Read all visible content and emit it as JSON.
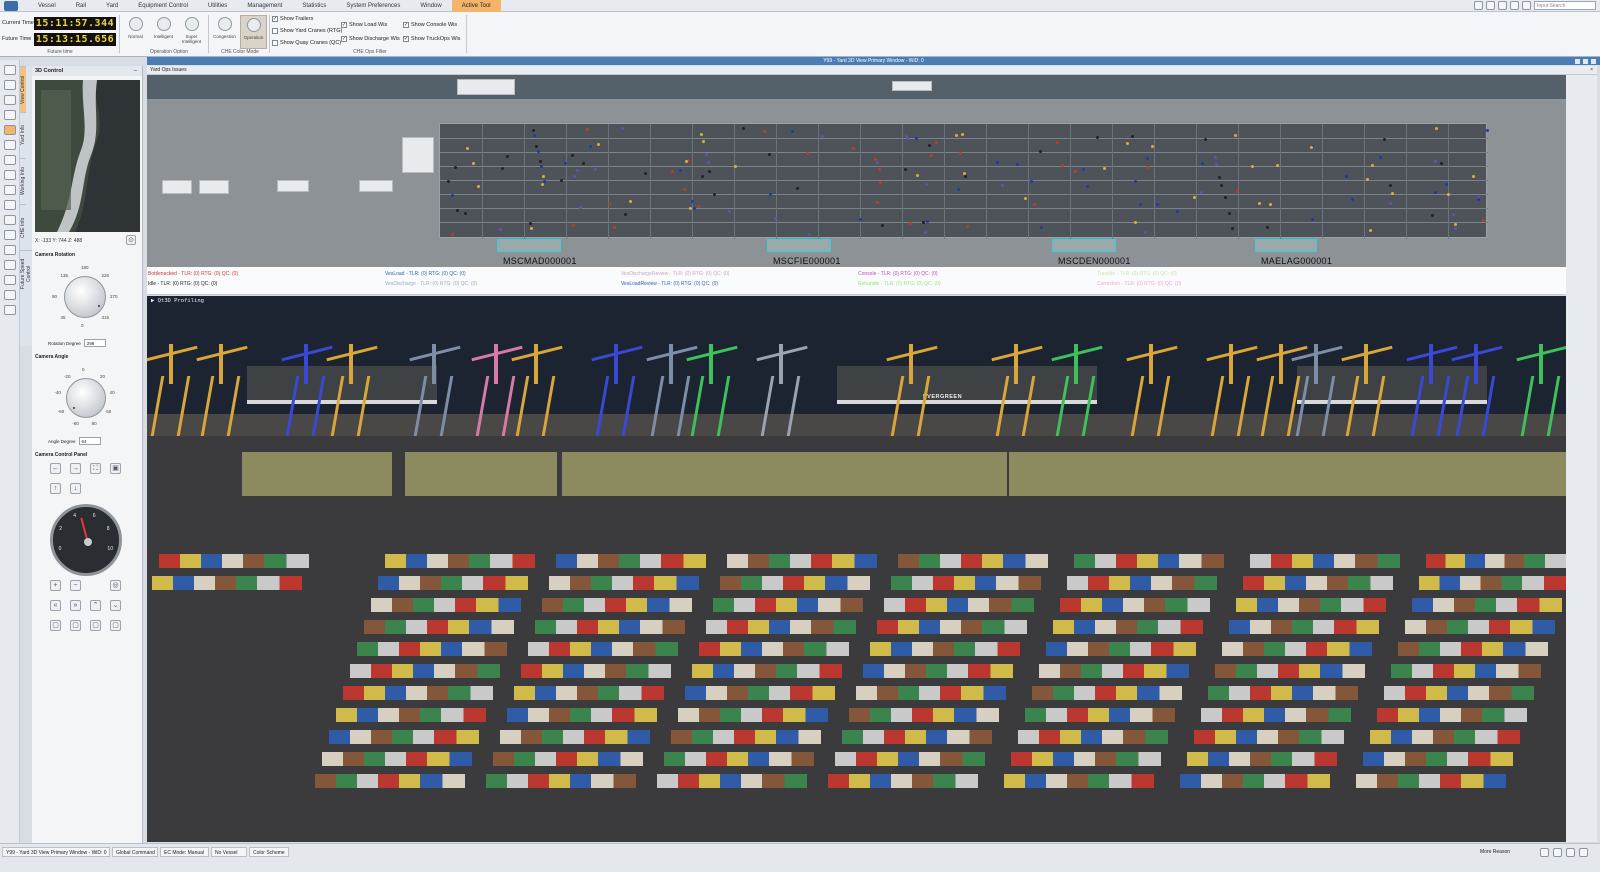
{
  "menubar": {
    "items": [
      "Vessel",
      "Rail",
      "Yard",
      "Equipment Control",
      "Utilities",
      "Management",
      "Statistics",
      "System Preferences",
      "Window",
      "Active Tool"
    ],
    "active_index": 9,
    "search_placeholder": "Input Search"
  },
  "ribbon": {
    "current_time_label": "Current Time",
    "current_time": "15:11:57.344",
    "future_time_label": "Future Time",
    "future_time": "15:13:15.656",
    "future_time_caption": "Future time",
    "operation_buttons": [
      "Normal",
      "Intelligent",
      "Super Intelligent"
    ],
    "operation_caption": "Operation Option",
    "che_buttons": [
      "Congestion",
      "Operation"
    ],
    "che_caption": "CHE Color Mode",
    "che_pressed": "Operation",
    "filters_col1": [
      {
        "label": "Show Trailers",
        "checked": true
      },
      {
        "label": "Show Yard Cranes (RTG)",
        "checked": false
      },
      {
        "label": "Show Quay Cranes (QC)",
        "checked": false
      }
    ],
    "filters_col2": [
      {
        "label": "Show Load Wis",
        "checked": true
      },
      {
        "label": "Show Discharge Wis",
        "checked": true
      }
    ],
    "filters_col3": [
      {
        "label": "Show Console Wis",
        "checked": true
      },
      {
        "label": "Show TruckOps Wis",
        "checked": true
      }
    ],
    "filter_caption": "CHE Ops Filter"
  },
  "window_title": "Y99 - Yard 3D View Primary Window - WiD: 0",
  "left_panel": {
    "title": "3D Control",
    "vertical_tabs": [
      "View Control",
      "Yard Info",
      "Working Info",
      "CHE Info",
      "Future Speed Control"
    ],
    "coords": "X: -133   Y: 744   Z: 488",
    "camera_rotation_label": "Camera Rotation",
    "rotation_ticks": [
      "180",
      "225",
      "270",
      "315",
      "0",
      "45",
      "90",
      "135"
    ],
    "rotation_degree_label": "Rotation Degree",
    "rotation_degree": "298",
    "camera_angle_label": "Camera Angle",
    "angle_ticks": [
      "0",
      "20",
      "40",
      "60",
      "80",
      "-80",
      "-60",
      "-40",
      "-20"
    ],
    "angle_degree_label": "Angle Degree",
    "angle_degree": "64",
    "camera_panel_label": "Camera Control Panel",
    "dial_numbers": [
      "0",
      "2",
      "4",
      "6",
      "8",
      "10"
    ]
  },
  "map": {
    "tab_label": "Yard Ops Issues",
    "vessels": [
      "MSCMAD000001",
      "MSCFIE000001",
      "MSCDEN000001",
      "MAELAG000001"
    ],
    "legend": [
      {
        "text": "Bottlenecked - TLR: (0) RTG: (0) QC: (0)",
        "color": "#d0342c"
      },
      {
        "text": "Idle - TLR: (0) RTG: (0) QC: (0)",
        "color": "#222222"
      },
      {
        "text": "VesLoad - TLR: (0) RTG: (0) QC: (0)",
        "color": "#2f5fb3"
      },
      {
        "text": "VesDischarge - TLR: (0) RTG: (0) QC: (0)",
        "color": "#9aa9c8"
      },
      {
        "text": "VesDischargeReview - TLR: (0) RTG: (0) QC: (0)",
        "color": "#c9a7c9"
      },
      {
        "text": "VesLoadReview - TLR: (0) RTG: (0) QC: (0)",
        "color": "#2f5fb3"
      },
      {
        "text": "Console - TLR: (0) RTG: (0) QC: (0)",
        "color": "#c04ac0"
      },
      {
        "text": "Rehandle - TLR: (0) RTG: (0) QC: (0)",
        "color": "#a6e07a"
      },
      {
        "text": "Transfer - TLR: (0) RTG: (0) QC: (0)",
        "color": "#c8e6a8"
      },
      {
        "text": "Correction - TLR: (0) RTG: (0) QC: (0)",
        "color": "#e8a8d0"
      }
    ]
  },
  "view3d": {
    "profiling_label": "▶ Qt3D Profiling",
    "ship_name": "EVERGREEN"
  },
  "statusbar": {
    "cells": [
      "Y99 - Yard 3D View Primary Window - WiD: 0",
      "Global Command",
      "EC Mode: Manual",
      "No Vessel",
      "Color Scheme"
    ],
    "right_label": "More Reason"
  },
  "colors": {
    "accent": "#f4b56a",
    "title_bar": "#4a7db3",
    "lcd_text": "#f2d23a"
  }
}
